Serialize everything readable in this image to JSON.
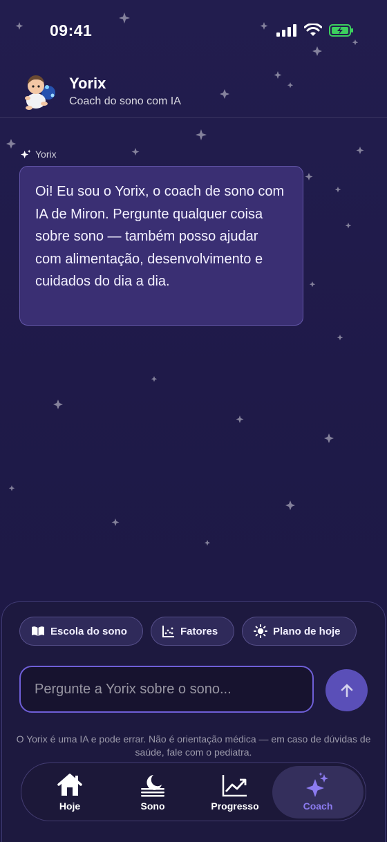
{
  "status_bar": {
    "time": "09:41"
  },
  "header": {
    "title": "Yorix",
    "subtitle": "Coach do sono com IA"
  },
  "chat": {
    "messages": [
      {
        "sender": "Yorix",
        "text": "Oi! Eu sou o Yorix, o coach de sono com IA de Miron. Pergunte qualquer coisa sobre sono — também posso ajudar com alimentação, desenvolvimento e cuidados do dia a dia."
      }
    ]
  },
  "quick_replies": [
    {
      "label": "Escola do sono",
      "icon": "book-icon"
    },
    {
      "label": "Fatores",
      "icon": "scatter-chart-icon"
    },
    {
      "label": "Plano de hoje",
      "icon": "sun-icon"
    }
  ],
  "composer": {
    "placeholder": "Pergunte a Yorix sobre o sono..."
  },
  "disclaimer": "O Yorix é uma IA e pode errar. Não é orientação médica — em caso de dúvidas de saúde, fale com o pediatra.",
  "tab_bar": {
    "items": [
      {
        "label": "Hoje",
        "icon": "home-icon"
      },
      {
        "label": "Sono",
        "icon": "moon-icon"
      },
      {
        "label": "Progresso",
        "icon": "trend-chart-icon"
      },
      {
        "label": "Coach",
        "icon": "sparkles-icon",
        "active": true
      }
    ]
  },
  "colors": {
    "accent": "#8c7bf0",
    "background": "#1f1a49",
    "bubble": "#3a2f73",
    "send": "#5a4fb8"
  }
}
